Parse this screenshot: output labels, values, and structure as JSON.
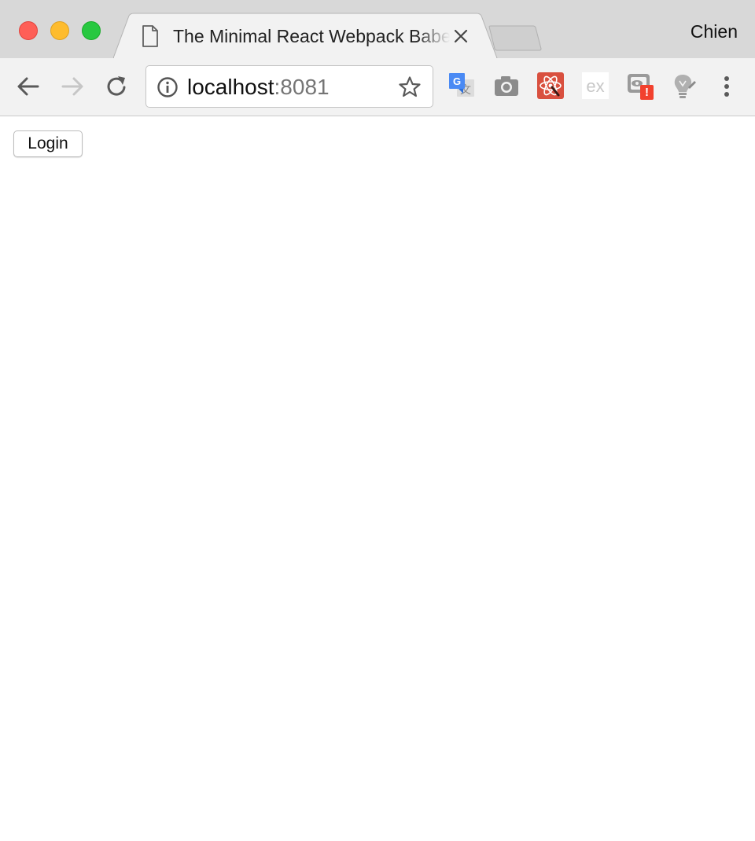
{
  "window": {
    "tab_title": "The Minimal React Webpack Babel Setup",
    "profile_name": "Chien"
  },
  "address_bar": {
    "host": "localhost",
    "port": ":8081"
  },
  "extensions": [
    "google-translate-icon",
    "camera-icon",
    "react-devtools-icon",
    "ex-icon",
    "eye-extension-icon",
    "lightbulb-icon"
  ],
  "extension_badge": "!",
  "page": {
    "login_label": "Login"
  },
  "colors": {
    "close": "#fe5f57",
    "minimize": "#febc2e",
    "maximize": "#28c840",
    "badge": "#f2412e"
  }
}
